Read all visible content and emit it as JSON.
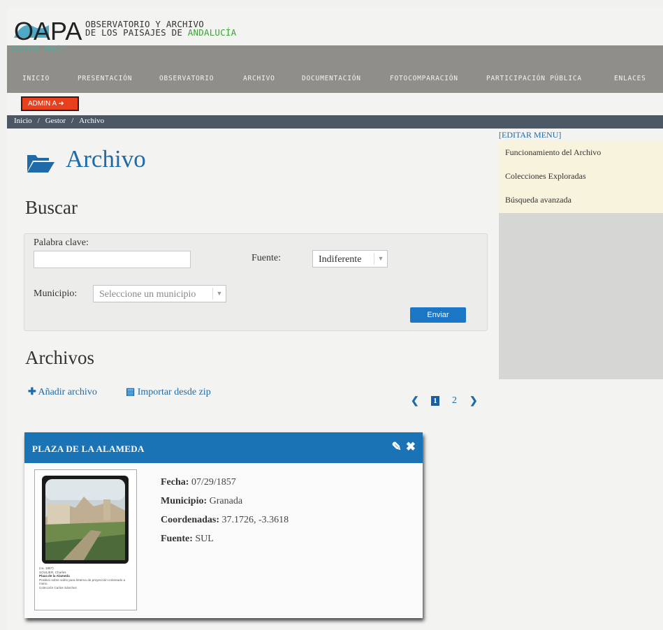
{
  "header": {
    "logo_text": "OAPA",
    "title_line1": "OBSERVATORIO Y ARCHIVO",
    "title_line2_prefix": "DE LOS PAISAJES DE ",
    "title_line2_accent": "ANDALUCÍA",
    "edit_menu": "[EDITAR MENÚ]"
  },
  "nav": {
    "items": [
      "INICIO",
      "PRESENTACIÓN",
      "OBSERVATORIO",
      "ARCHIVO",
      "DOCUMENTACIÓN",
      "FOTOCOMPARACIÓN",
      "PARTICIPACIÓN PÚBLICA",
      "ENLACES"
    ]
  },
  "admin_button": "ADMIN A",
  "breadcrumb": [
    "Inicio",
    "Gestor",
    "Archivo"
  ],
  "page_title": "Archivo",
  "search": {
    "heading": "Buscar",
    "keyword_label": "Palabra clave:",
    "source_label": "Fuente:",
    "source_value": "Indiferente",
    "municipality_label": "Municipio:",
    "municipality_placeholder": "Seleccione un municipio",
    "submit_label": "Enviar"
  },
  "files": {
    "heading": "Archivos",
    "add_label": "Añadir archivo",
    "import_label": "Importar desde zip"
  },
  "pagination": {
    "current": "1",
    "next_page": "2"
  },
  "card": {
    "title": "PLAZA DE LA ALAMEDA",
    "fields": [
      {
        "key": "Fecha:",
        "value": "07/29/1857"
      },
      {
        "key": "Municipio:",
        "value": "Granada"
      },
      {
        "key": "Coordenadas:",
        "value": "37.1726, -3.3618"
      },
      {
        "key": "Fuente:",
        "value": "SUL"
      }
    ],
    "thumb_caption": {
      "line1": "(ca. 1857)",
      "line2": "SOULIER, Charles",
      "line3": "Plaza de la Alameda",
      "line4": "Positivo sobre vidrio para linterna de proyección coloreado a mano.",
      "line5": "Colección Carlos Sánchez"
    }
  },
  "sidebar": {
    "edit_menu": "[EDITAR MENU]",
    "items": [
      "Funcionamiento del Archivo",
      "Colecciones Exploradas",
      "Búsqueda avanzada"
    ]
  },
  "colors": {
    "primary_blue": "#1f6aa8",
    "card_header": "#1a73b5",
    "nav_bg": "#8f8e89",
    "admin_orange": "#e8401c",
    "accent_green": "#3aa335"
  }
}
